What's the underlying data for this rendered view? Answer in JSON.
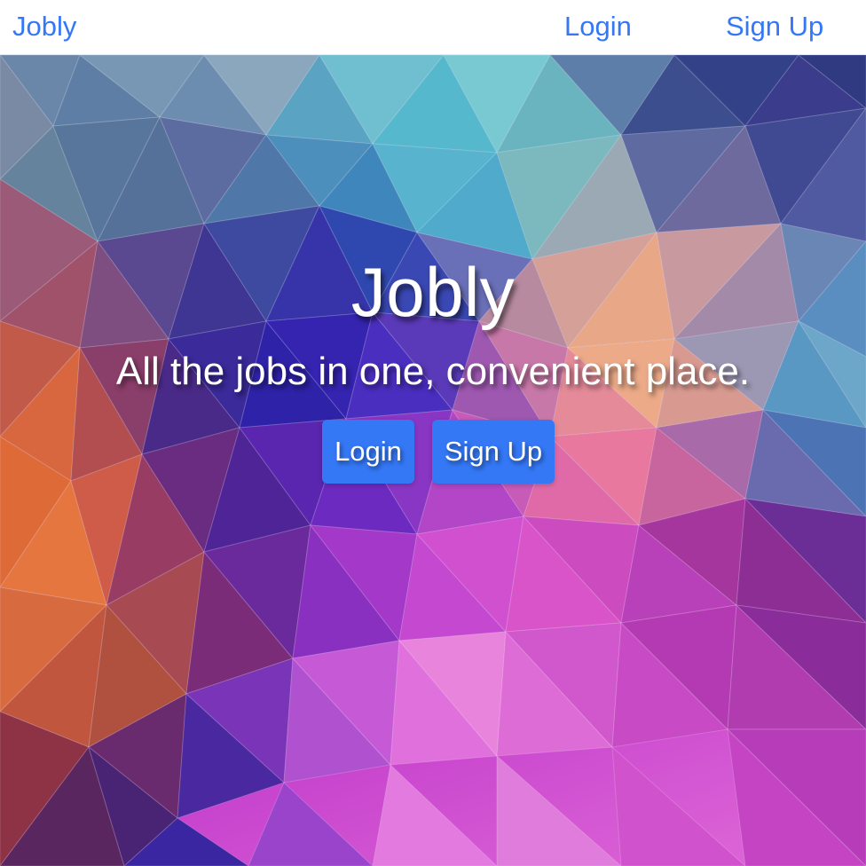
{
  "navbar": {
    "brand": "Jobly",
    "login_label": "Login",
    "signup_label": "Sign Up"
  },
  "hero": {
    "title": "Jobly",
    "tagline": "All the jobs in one, convenient place.",
    "login_button": "Login",
    "signup_button": "Sign Up"
  },
  "colors": {
    "accent": "#3478f6",
    "navbar_bg": "#ffffff",
    "hero_text": "#ffffff"
  }
}
